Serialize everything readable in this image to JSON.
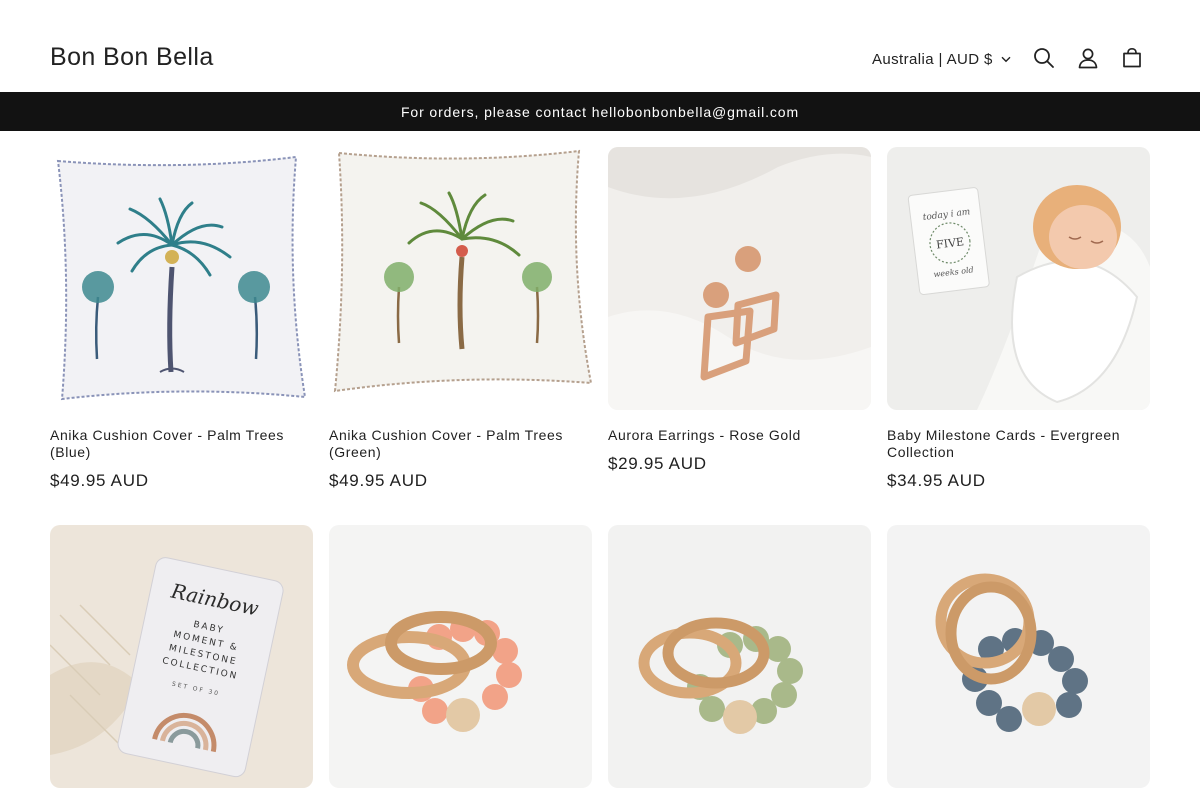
{
  "store": {
    "name": "Bon Bon Bella"
  },
  "header": {
    "locale_label": "Australia | AUD $",
    "icons": [
      "search-icon",
      "account-icon",
      "cart-icon"
    ]
  },
  "announcement": {
    "text": "For orders, please contact hellobonbonbella@gmail.com"
  },
  "colors": {
    "announcement_bg": "#121212",
    "text": "#121212",
    "background": "#ffffff"
  },
  "products": [
    {
      "title": "Anika Cushion Cover - Palm Trees (Blue)",
      "price": "$49.95 AUD",
      "image": "white cushion with blue palm tree embroidery"
    },
    {
      "title": "Anika Cushion Cover - Palm Trees (Green)",
      "price": "$49.95 AUD",
      "image": "white cushion with green palm tree embroidery"
    },
    {
      "title": "Aurora Earrings - Rose Gold",
      "price": "$29.95 AUD",
      "image": "rose gold textured drop earrings on white fabric"
    },
    {
      "title": "Baby Milestone Cards - Evergreen Collection",
      "price": "$34.95 AUD",
      "image": "sleeping newborn with milestone card"
    },
    {
      "title": "",
      "price": "",
      "image": "rainbow milestone card set on lace"
    },
    {
      "title": "",
      "price": "",
      "image": "wooden teether rings with peach silicone beads"
    },
    {
      "title": "",
      "price": "",
      "image": "wooden teether rings with sage silicone beads"
    },
    {
      "title": "",
      "price": "",
      "image": "wooden teether rings with slate blue silicone beads"
    }
  ],
  "card_text": {
    "rainbow": [
      "Rainbow",
      "BABY",
      "MOMENT &",
      "MILESTONE",
      "COLLECTION",
      "SET OF 30"
    ],
    "milestone": [
      "today i am",
      "FIVE",
      "weeks old"
    ]
  }
}
